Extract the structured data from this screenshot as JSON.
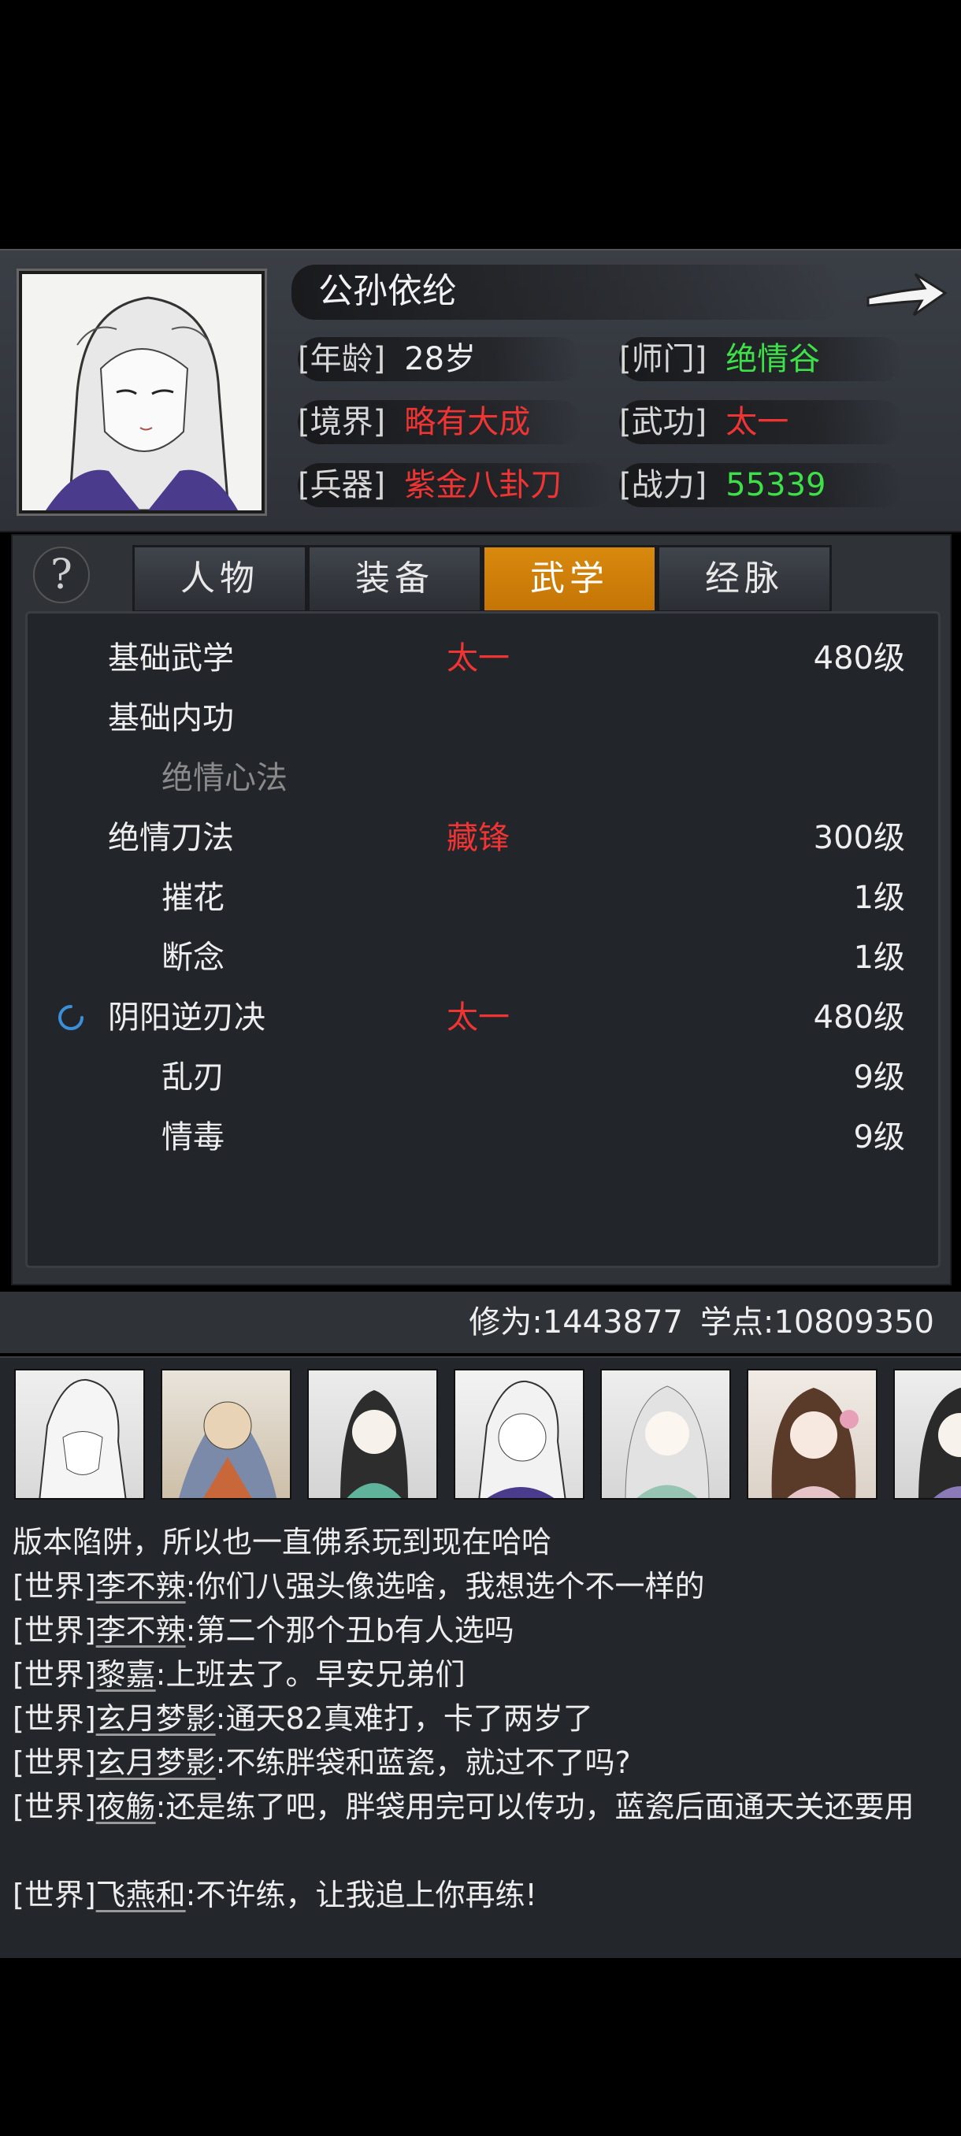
{
  "character": {
    "name": "公孙依纶",
    "stats": [
      {
        "key": "[年龄]",
        "value": "28岁",
        "color": "#eeeeee"
      },
      {
        "key": "[师门]",
        "value": "绝情谷",
        "color": "#3ee04a"
      },
      {
        "key": "[境界]",
        "value": "略有大成",
        "color": "#ef3434"
      },
      {
        "key": "[武功]",
        "value": "太一",
        "color": "#ef3434"
      },
      {
        "key": "[兵器]",
        "value": "紫金八卦刀",
        "color": "#ef3434"
      },
      {
        "key": "[战力]",
        "value": "55339",
        "color": "#3ee04a"
      }
    ]
  },
  "tabs": [
    {
      "label": "人物",
      "active": false
    },
    {
      "label": "装备",
      "active": false
    },
    {
      "label": "武学",
      "active": true
    },
    {
      "label": "经脉",
      "active": false
    }
  ],
  "help_label": "?",
  "skills": [
    {
      "name": "基础武学",
      "tier": "太一",
      "level": "480级",
      "indent": false
    },
    {
      "name": "基础内功",
      "tier": "",
      "level": "",
      "indent": false
    },
    {
      "name": "绝情心法",
      "tier": "",
      "level": "",
      "indent": true,
      "dim": true
    },
    {
      "name": "绝情刀法",
      "tier": "藏锋",
      "level": "300级",
      "indent": false
    },
    {
      "name": "摧花",
      "tier": "",
      "level": "1级",
      "indent": true
    },
    {
      "name": "断念",
      "tier": "",
      "level": "1级",
      "indent": true
    },
    {
      "name": "阴阳逆刃决",
      "tier": "太一",
      "level": "480级",
      "indent": false,
      "spinner": true
    },
    {
      "name": "乱刃",
      "tier": "",
      "level": "9级",
      "indent": true
    },
    {
      "name": "情毒",
      "tier": "",
      "level": "9级",
      "indent": true
    }
  ],
  "progress": {
    "cultivation": "修为:1443877",
    "points": "学点:10809350"
  },
  "chat": [
    {
      "channel": "",
      "user": "",
      "text": "版本陷阱，所以也一直佛系玩到现在哈哈"
    },
    {
      "channel": "[世界]",
      "user": "李不辣",
      "text": ":你们八强头像选啥，我想选个不一样的"
    },
    {
      "channel": "[世界]",
      "user": "李不辣",
      "text": ":第二个那个丑b有人选吗"
    },
    {
      "channel": "[世界]",
      "user": "黎嘉",
      "text": ":上班去了。早安兄弟们"
    },
    {
      "channel": "[世界]",
      "user": "玄月梦影",
      "text": ":通天82真难打，卡了两岁了"
    },
    {
      "channel": "[世界]",
      "user": "玄月梦影",
      "text": ":不练胖袋和蓝瓷，就过不了吗?"
    },
    {
      "channel": "[世界]",
      "user": "夜觞",
      "text": ":还是练了吧，胖袋用完可以传功，蓝瓷后面通天关还要用"
    },
    {
      "channel": "[世界]",
      "user": "飞燕和",
      "text": ":不许练，让我追上你再练!"
    }
  ]
}
